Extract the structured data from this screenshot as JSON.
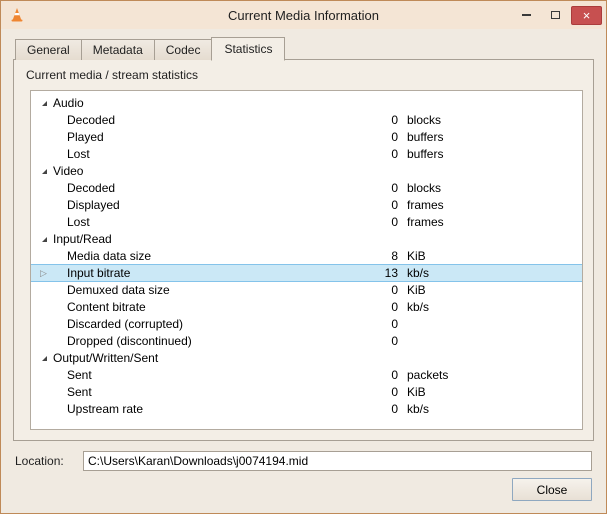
{
  "window": {
    "title": "Current Media Information",
    "controls": {
      "minimize": "minimize",
      "maximize": "maximize",
      "close": "×"
    }
  },
  "tabs": [
    "General",
    "Metadata",
    "Codec",
    "Statistics"
  ],
  "active_tab": "Statistics",
  "statistics": {
    "subtitle": "Current media / stream statistics",
    "tree": [
      {
        "type": "group",
        "label": "Audio"
      },
      {
        "type": "item",
        "label": "Decoded",
        "value": "0",
        "unit": "blocks"
      },
      {
        "type": "item",
        "label": "Played",
        "value": "0",
        "unit": "buffers"
      },
      {
        "type": "item",
        "label": "Lost",
        "value": "0",
        "unit": "buffers"
      },
      {
        "type": "group",
        "label": "Video"
      },
      {
        "type": "item",
        "label": "Decoded",
        "value": "0",
        "unit": "blocks"
      },
      {
        "type": "item",
        "label": "Displayed",
        "value": "0",
        "unit": "frames"
      },
      {
        "type": "item",
        "label": "Lost",
        "value": "0",
        "unit": "frames"
      },
      {
        "type": "group",
        "label": "Input/Read"
      },
      {
        "type": "item",
        "label": "Media data size",
        "value": "8",
        "unit": "KiB"
      },
      {
        "type": "item",
        "label": "Input bitrate",
        "value": "13",
        "unit": "kb/s",
        "selected": true
      },
      {
        "type": "item",
        "label": "Demuxed data size",
        "value": "0",
        "unit": "KiB"
      },
      {
        "type": "item",
        "label": "Content bitrate",
        "value": "0",
        "unit": "kb/s"
      },
      {
        "type": "item",
        "label": "Discarded (corrupted)",
        "value": "0",
        "unit": ""
      },
      {
        "type": "item",
        "label": "Dropped (discontinued)",
        "value": "0",
        "unit": ""
      },
      {
        "type": "group",
        "label": "Output/Written/Sent"
      },
      {
        "type": "item",
        "label": "Sent",
        "value": "0",
        "unit": "packets"
      },
      {
        "type": "item",
        "label": "Sent",
        "value": "0",
        "unit": "KiB"
      },
      {
        "type": "item",
        "label": "Upstream rate",
        "value": "0",
        "unit": "kb/s"
      }
    ]
  },
  "footer": {
    "location_label": "Location:",
    "location_value": "C:\\Users\\Karan\\Downloads\\j0074194.mid",
    "close_button": "Close"
  },
  "colors": {
    "titlebar_bg": "#f4e5d5",
    "window_border": "#bf8a58",
    "close_window_red": "#c75050",
    "selection_bg": "#cbe8f6",
    "selection_border": "#84c3ea"
  }
}
